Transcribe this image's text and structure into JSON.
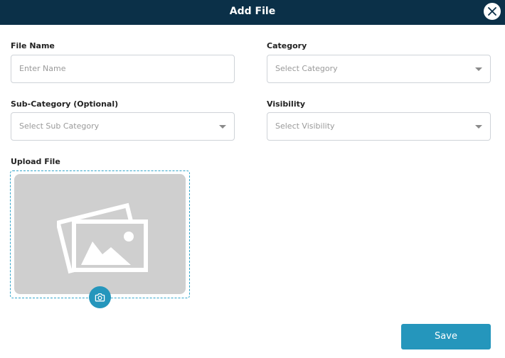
{
  "header": {
    "title": "Add File"
  },
  "fields": {
    "file_name": {
      "label": "File Name",
      "placeholder": "Enter Name"
    },
    "category": {
      "label": "Category",
      "placeholder": "Select Category"
    },
    "sub_category": {
      "label": "Sub-Category (Optional)",
      "placeholder": "Select Sub Category"
    },
    "visibility": {
      "label": "Visibility",
      "placeholder": "Select Visibility"
    }
  },
  "upload": {
    "label": "Upload File"
  },
  "actions": {
    "save_label": "Save"
  },
  "icons": {
    "close": "close-icon",
    "image_placeholder": "image-placeholder-icon",
    "camera": "camera-icon",
    "dropdown": "chevron-down-icon"
  },
  "colors": {
    "header_bg": "#0b3048",
    "accent": "#2596bc",
    "upload_border": "#2fa3c9",
    "preview_bg": "#cfcfcf"
  }
}
